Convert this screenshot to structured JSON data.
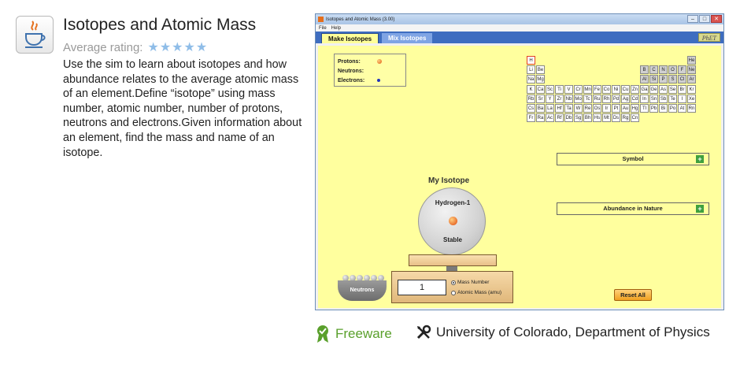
{
  "app": {
    "title": "Isotopes and Atomic Mass",
    "rating_label": "Average rating:",
    "rating_stars": 5,
    "description": "Use the sim to learn about isotopes and how abundance relates to the average atomic mass of an element.Define “isotope” using mass number, atomic number, number of protons, neutrons and electrons.Given information about an element, find the mass and name of an isotope."
  },
  "window": {
    "title": "Isotopes and Atomic Mass (3.00)",
    "menu": [
      "File",
      "Help"
    ],
    "tabs": [
      {
        "label": "Make Isotopes",
        "active": true
      },
      {
        "label": "Mix Isotopes",
        "active": false
      }
    ],
    "logo": "PhET"
  },
  "sim": {
    "legend": {
      "protons": "Protons:",
      "neutrons": "Neutrons:",
      "electrons": "Electrons:"
    },
    "periodic_table": {
      "rows": [
        {
          "row": 0,
          "start": 0,
          "cells": [
            "H"
          ]
        },
        {
          "row": 0,
          "start": 17,
          "cells": [
            "He"
          ]
        },
        {
          "row": 1,
          "start": 0,
          "cells": [
            "Li",
            "Be"
          ]
        },
        {
          "row": 1,
          "start": 12,
          "cells": [
            "B",
            "C",
            "N",
            "O",
            "F",
            "Ne"
          ]
        },
        {
          "row": 2,
          "start": 0,
          "cells": [
            "Na",
            "Mg"
          ]
        },
        {
          "row": 2,
          "start": 12,
          "cells": [
            "Al",
            "Si",
            "P",
            "S",
            "Cl",
            "Ar"
          ]
        },
        {
          "row": 3,
          "start": 0,
          "cells": [
            "K",
            "Ca",
            "Sc",
            "Ti",
            "V",
            "Cr",
            "Mn",
            "Fe",
            "Co",
            "Ni",
            "Cu",
            "Zn",
            "Ga",
            "Ge",
            "As",
            "Se",
            "Br",
            "Kr"
          ]
        },
        {
          "row": 4,
          "start": 0,
          "cells": [
            "Rb",
            "Sr",
            "Y",
            "Zr",
            "Nb",
            "Mo",
            "Tc",
            "Ru",
            "Rh",
            "Pd",
            "Ag",
            "Cd",
            "In",
            "Sn",
            "Sb",
            "Te",
            "I",
            "Xe"
          ]
        },
        {
          "row": 5,
          "start": 0,
          "cells": [
            "Cs",
            "Ba",
            "La",
            "Hf",
            "Ta",
            "W",
            "Re",
            "Os",
            "Ir",
            "Pt",
            "Au",
            "Hg",
            "Tl",
            "Pb",
            "Bi",
            "Po",
            "At",
            "Rn"
          ]
        },
        {
          "row": 6,
          "start": 0,
          "cells": [
            "Fr",
            "Ra",
            "Ac",
            "Rf",
            "Db",
            "Sg",
            "Bh",
            "Hs",
            "Mt",
            "Ds",
            "Rg",
            "Cn"
          ]
        }
      ],
      "selected": "H"
    },
    "symbol_label": "Symbol",
    "abundance_label": "Abundance in Nature",
    "my_isotope_label": "My Isotope",
    "isotope_name": "Hydrogen-1",
    "stability": "Stable",
    "scale_value": "1",
    "mass_number_label": "Mass Number",
    "atomic_mass_label": "Atomic Mass (amu)",
    "neutrons_bucket": "Neutrons",
    "reset_label": "Reset All"
  },
  "footer": {
    "license": "Freeware",
    "publisher": "University of Colorado, Department of Physics"
  },
  "colors": {
    "sim_bg": "#ffff9e",
    "tab_bar": "#3e6dc0",
    "freeware": "#5aa02c",
    "rating_star": "#8fbde8"
  }
}
